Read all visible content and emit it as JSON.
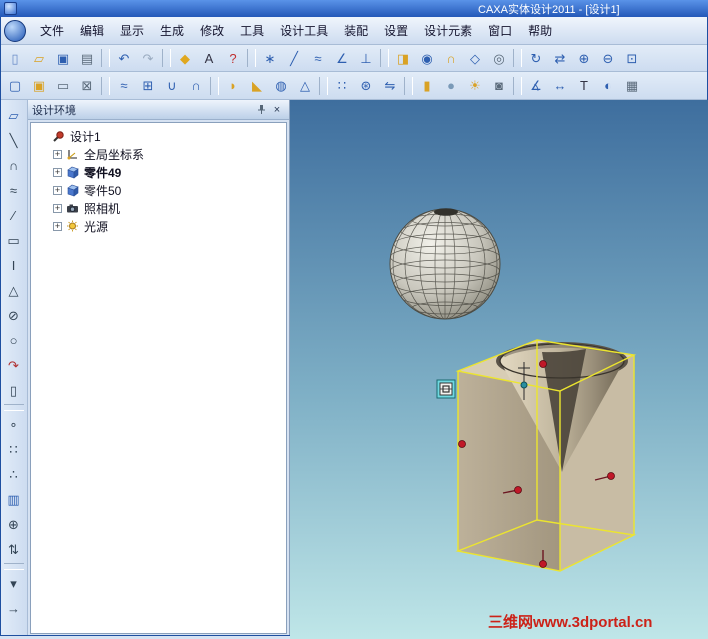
{
  "window": {
    "title": "CAXA实体设计2011 - [设计1]"
  },
  "menubar": {
    "items": [
      "文件",
      "编辑",
      "显示",
      "生成",
      "修改",
      "工具",
      "设计工具",
      "装配",
      "设置",
      "设计元素",
      "窗口",
      "帮助"
    ]
  },
  "toolbar_top": {
    "icons": [
      {
        "n": "new-document",
        "g": "▯",
        "c": "#6a8cc8"
      },
      {
        "n": "open-file",
        "g": "▱",
        "c": "#d9a225"
      },
      {
        "n": "save",
        "g": "▣",
        "c": "#2e5fb0"
      },
      {
        "n": "print",
        "g": "▤",
        "c": "#5a6a7a"
      },
      {
        "n": "separator",
        "ia": "false"
      },
      {
        "n": "undo",
        "g": "↶",
        "c": "#2e5fb0"
      },
      {
        "n": "redo",
        "g": "↷",
        "c": "#9aabc0"
      },
      {
        "n": "separator",
        "ia": "false"
      },
      {
        "n": "innovation-mode",
        "g": "◆",
        "c": "#e0a820"
      },
      {
        "n": "annotation-text",
        "g": "A",
        "c": "#333344"
      },
      {
        "n": "context-help",
        "g": "?",
        "c": "#c03030"
      },
      {
        "n": "separator",
        "ia": "false"
      },
      {
        "n": "point-tool",
        "g": "∗",
        "c": "#2e5fb0"
      },
      {
        "n": "line-tool",
        "g": "╱",
        "c": "#2e5fb0"
      },
      {
        "n": "spline-tool",
        "g": "≈",
        "c": "#2e5fb0"
      },
      {
        "n": "angle-tool",
        "g": "∠",
        "c": "#2e5fb0"
      },
      {
        "n": "perpendicular-tool",
        "g": "⊥",
        "c": "#2e5fb0"
      },
      {
        "n": "separator",
        "ia": "false"
      },
      {
        "n": "extrude-feature",
        "g": "◨",
        "c": "#d9a225"
      },
      {
        "n": "revolve-feature",
        "g": "◉",
        "c": "#2e5fb0"
      },
      {
        "n": "sweep-feature",
        "g": "∩",
        "c": "#d9a225"
      },
      {
        "n": "loft-feature",
        "g": "◇",
        "c": "#2e5fb0"
      },
      {
        "n": "hole-feature",
        "g": "◎",
        "c": "#5a6a7a"
      },
      {
        "n": "separator",
        "ia": "false"
      },
      {
        "n": "rotate-view",
        "g": "↻",
        "c": "#2e5fb0"
      },
      {
        "n": "pan-view",
        "g": "⇄",
        "c": "#2e5fb0"
      },
      {
        "n": "zoom-in",
        "g": "⊕",
        "c": "#2e5fb0"
      },
      {
        "n": "zoom-out",
        "g": "⊖",
        "c": "#2e5fb0"
      },
      {
        "n": "fit-view",
        "g": "⊡",
        "c": "#2e5fb0"
      }
    ]
  },
  "toolbar_second": {
    "icons": [
      {
        "n": "sketch-plane",
        "g": "▢",
        "c": "#2e5fb0"
      },
      {
        "n": "sketch-3d",
        "g": "▣",
        "c": "#d9a225"
      },
      {
        "n": "edit-tool",
        "g": "▭",
        "c": "#5a6a7a"
      },
      {
        "n": "erase-tool",
        "g": "⊠",
        "c": "#5a6a7a"
      },
      {
        "n": "separator",
        "ia": "false"
      },
      {
        "n": "wave-surface",
        "g": "≈",
        "c": "#2e5fb0"
      },
      {
        "n": "mesh-grid",
        "g": "⊞",
        "c": "#2e5fb0"
      },
      {
        "n": "union-boolean",
        "g": "∪",
        "c": "#2e5fb0"
      },
      {
        "n": "intersect-boolean",
        "g": "∩",
        "c": "#2e5fb0"
      },
      {
        "n": "separator",
        "ia": "false"
      },
      {
        "n": "fillet-edge",
        "g": "◗",
        "c": "#d9a225"
      },
      {
        "n": "chamfer-edge",
        "g": "◣",
        "c": "#d9a225"
      },
      {
        "n": "shell-feature",
        "g": "◍",
        "c": "#2e5fb0"
      },
      {
        "n": "draft-feature",
        "g": "△",
        "c": "#2e5fb0"
      },
      {
        "n": "separator",
        "ia": "false"
      },
      {
        "n": "linear-pattern",
        "g": "∷",
        "c": "#2e5fb0"
      },
      {
        "n": "circular-pattern",
        "g": "⊛",
        "c": "#2e5fb0"
      },
      {
        "n": "mirror-feature",
        "g": "⇋",
        "c": "#2e5fb0"
      },
      {
        "n": "separator",
        "ia": "false"
      },
      {
        "n": "material-tool",
        "g": "▮",
        "c": "#d9a225"
      },
      {
        "n": "render-tool",
        "g": "●",
        "c": "#7a9ab8"
      },
      {
        "n": "light-source-tool",
        "g": "☀",
        "c": "#d9a225"
      },
      {
        "n": "camera-view-tool",
        "g": "◙",
        "c": "#5a6a7a"
      },
      {
        "n": "separator",
        "ia": "false"
      },
      {
        "n": "measure-angle",
        "g": "∡",
        "c": "#2e5fb0"
      },
      {
        "n": "measure-distance",
        "g": "↔",
        "c": "#2e5fb0"
      },
      {
        "n": "text-annotation",
        "g": "T",
        "c": "#333344"
      },
      {
        "n": "display-shaded",
        "g": "◐",
        "c": "#2e5fb0"
      },
      {
        "n": "options-grid",
        "g": "▦",
        "c": "#5a6a7a"
      }
    ]
  },
  "tool_column": {
    "icons": [
      {
        "n": "select-edit",
        "g": "▱",
        "c": "#2e5fb0"
      },
      {
        "n": "draw-line",
        "g": "╲",
        "c": "#334455"
      },
      {
        "n": "draw-arc",
        "g": "∩",
        "c": "#334455"
      },
      {
        "n": "draw-spline",
        "g": "≈",
        "c": "#334455"
      },
      {
        "n": "draw-segment",
        "g": "∕",
        "c": "#334455"
      },
      {
        "n": "draw-rectangle",
        "g": "▭",
        "c": "#334455"
      },
      {
        "n": "draw-text",
        "g": "I",
        "c": "#334455"
      },
      {
        "n": "draw-triangle",
        "g": "△",
        "c": "#334455"
      },
      {
        "n": "draw-circle",
        "g": "⊘",
        "c": "#334455"
      },
      {
        "n": "draw-polygon",
        "g": "○",
        "c": "#334455"
      },
      {
        "n": "draw-arc-arrow",
        "g": "↷",
        "c": "#b03030"
      },
      {
        "n": "draw-column",
        "g": "▯",
        "c": "#334455"
      },
      {
        "n": "separator",
        "ia": "false"
      },
      {
        "n": "pattern-circle",
        "g": "∘",
        "c": "#334455"
      },
      {
        "n": "pattern-dots",
        "g": "∷",
        "c": "#334455"
      },
      {
        "n": "pattern-points",
        "g": "∴",
        "c": "#334455"
      },
      {
        "n": "stack-cylinder",
        "g": "▥",
        "c": "#2e5fb0"
      },
      {
        "n": "axes-widget",
        "g": "⊕",
        "c": "#334455"
      },
      {
        "n": "move-vertical",
        "g": "⇅",
        "c": "#334455"
      },
      {
        "n": "separator",
        "ia": "false"
      },
      {
        "n": "more-tools",
        "g": "▾",
        "c": "#334455"
      },
      {
        "n": "scroll-arrow",
        "g": "→",
        "c": "#334455"
      }
    ]
  },
  "panel": {
    "title": "设计环境",
    "close_glyph": "×",
    "tree": [
      {
        "depth": "0",
        "expander": "",
        "icon": "design",
        "iconName": "design-icon",
        "label": "设计1",
        "style": ""
      },
      {
        "depth": "1",
        "expander": "+",
        "icon": "axes",
        "iconName": "coordinate-system-icon",
        "label": "全局坐标系",
        "style": ""
      },
      {
        "depth": "1",
        "expander": "+",
        "icon": "part",
        "iconName": "part-icon",
        "label": "零件49",
        "style": "bold"
      },
      {
        "depth": "1",
        "expander": "+",
        "icon": "part",
        "iconName": "part-icon",
        "label": "零件50",
        "style": ""
      },
      {
        "depth": "1",
        "expander": "+",
        "icon": "camera",
        "iconName": "camera-icon",
        "label": "照相机",
        "style": ""
      },
      {
        "depth": "1",
        "expander": "+",
        "icon": "light",
        "iconName": "light-icon",
        "label": "光源",
        "style": ""
      }
    ]
  },
  "viewport": {
    "watermark": "三维网www.3dportal.cn"
  },
  "colors": {
    "titlebar_blue": "#2458b8",
    "viewport_top": "#3e6e9e",
    "viewport_bottom": "#bfe6e8",
    "wireframe_yellow": "#ece52e",
    "control_point_red": "#c01828",
    "selection_teal": "#6fd8e0",
    "watermark_red": "#cc2218"
  }
}
